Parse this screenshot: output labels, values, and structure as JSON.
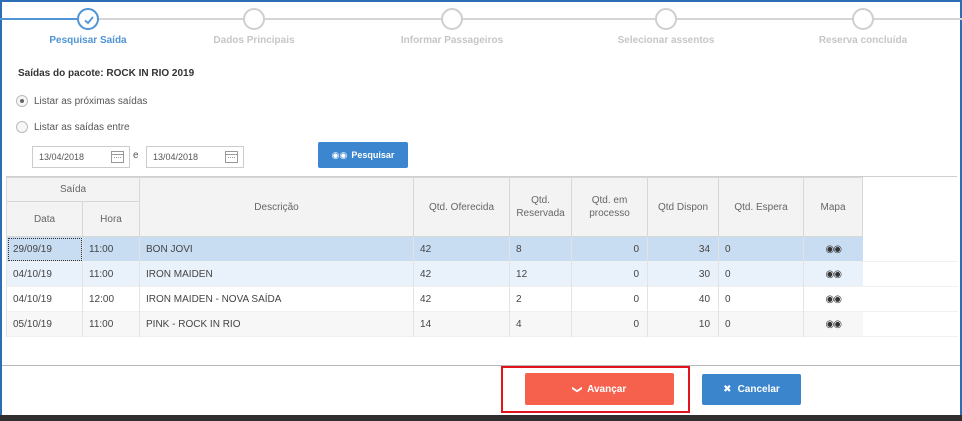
{
  "wizard": {
    "steps": [
      {
        "label": "Pesquisar Saída",
        "active": true
      },
      {
        "label": "Dados Principais",
        "active": false
      },
      {
        "label": "Informar Passageiros",
        "active": false
      },
      {
        "label": "Selecionar assentos",
        "active": false
      },
      {
        "label": "Reserva concluída",
        "active": false
      }
    ]
  },
  "search": {
    "package_title": "Saídas do pacote: ROCK IN RIO 2019",
    "radio_next": "Listar as próximas saídas",
    "radio_between": "Listar as saídas entre",
    "date_from": "13/04/2018",
    "date_to": "13/04/2018",
    "date_separator": "e",
    "search_button": "Pesquisar",
    "search_icon": "binoculars-icon"
  },
  "table": {
    "group_header": "Saída",
    "headers": {
      "date": "Data",
      "time": "Hora",
      "description": "Descrição",
      "offered": "Qtd. Oferecida",
      "reserved": "Qtd. Reservada",
      "processing": "Qtd. em processo",
      "available": "Qtd Dispon",
      "waiting": "Qtd. Espera",
      "map": "Mapa"
    },
    "rows": [
      {
        "date": "29/09/19",
        "time": "11:00",
        "description": "BON JOVI",
        "offered": "42",
        "reserved": "8",
        "processing": "0",
        "available": "34",
        "waiting": "0",
        "map_icon": "binoculars-icon"
      },
      {
        "date": "04/10/19",
        "time": "11:00",
        "description": "IRON MAIDEN",
        "offered": "42",
        "reserved": "12",
        "processing": "0",
        "available": "30",
        "waiting": "0",
        "map_icon": "binoculars-icon"
      },
      {
        "date": "04/10/19",
        "time": "12:00",
        "description": "IRON MAIDEN - NOVA SAÍDA",
        "offered": "42",
        "reserved": "2",
        "processing": "0",
        "available": "40",
        "waiting": "0",
        "map_icon": "binoculars-icon"
      },
      {
        "date": "05/10/19",
        "time": "11:00",
        "description": "PINK - ROCK IN RIO",
        "offered": "14",
        "reserved": "4",
        "processing": "0",
        "available": "10",
        "waiting": "0",
        "map_icon": "binoculars-icon"
      }
    ]
  },
  "footer": {
    "advance_label": "Avançar",
    "cancel_label": "Cancelar",
    "advance_icon": "chevron-down-icon",
    "cancel_icon": "close-icon"
  },
  "colors": {
    "accent": "#4f94d4",
    "advance": "#f5614d",
    "highlight_frame": "#e0141a",
    "selected_row": "#c8dcf2"
  }
}
